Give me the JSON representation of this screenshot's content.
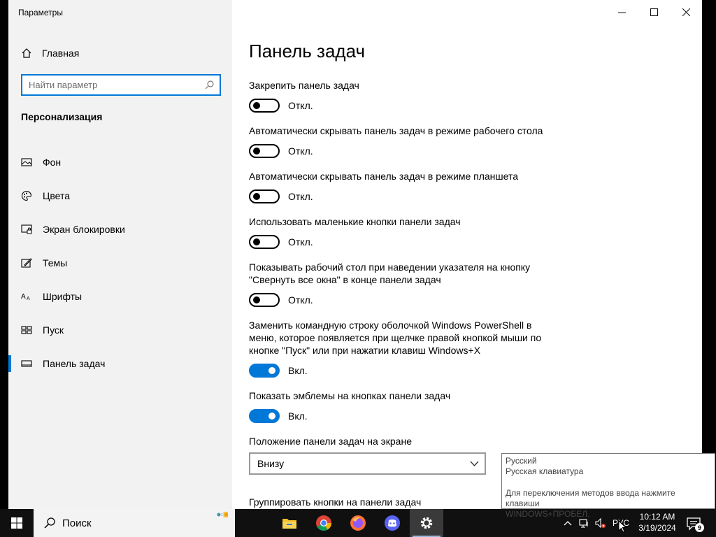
{
  "window": {
    "title": "Параметры",
    "accent_color": "#0078d7"
  },
  "sidebar": {
    "home_label": "Главная",
    "search_placeholder": "Найти параметр",
    "section_title": "Персонализация",
    "items": [
      {
        "label": "Фон",
        "icon": "image-icon"
      },
      {
        "label": "Цвета",
        "icon": "palette-icon"
      },
      {
        "label": "Экран блокировки",
        "icon": "lock-screen-icon"
      },
      {
        "label": "Темы",
        "icon": "themes-icon"
      },
      {
        "label": "Шрифты",
        "icon": "fonts-icon"
      },
      {
        "label": "Пуск",
        "icon": "start-icon"
      },
      {
        "label": "Панель задач",
        "icon": "taskbar-icon",
        "active": true
      }
    ]
  },
  "main": {
    "title": "Панель задач",
    "settings": [
      {
        "label": "Закрепить панель задач",
        "state": "Откл.",
        "on": false
      },
      {
        "label": "Автоматически скрывать панель задач в режиме рабочего стола",
        "state": "Откл.",
        "on": false
      },
      {
        "label": "Автоматически скрывать панель задач в режиме планшета",
        "state": "Откл.",
        "on": false
      },
      {
        "label": "Использовать маленькие кнопки панели задач",
        "state": "Откл.",
        "on": false
      },
      {
        "label": "Показывать рабочий стол при наведении указателя на кнопку \"Свернуть все окна\" в конце панели задач",
        "state": "Откл.",
        "on": false
      },
      {
        "label": "Заменить командную строку оболочкой Windows PowerShell в меню, которое появляется при щелчке правой кнопкой мыши по кнопке \"Пуск\" или при нажатии клавиш Windows+X",
        "state": "Вкл.",
        "on": true
      },
      {
        "label": "Показать эмблемы на кнопках панели задач",
        "state": "Вкл.",
        "on": true
      }
    ],
    "position_label": "Положение панели задач на экране",
    "position_value": "Внизу",
    "next_label": "Группировать кнопки на панели задач"
  },
  "tooltip": {
    "line1": "Русский",
    "line2": "Русская клавиатура",
    "line3": "Для переключения методов ввода нажмите клавиши",
    "line4": "WINDOWS+ПРОБЕЛ."
  },
  "taskbar": {
    "search_label": "Поиск",
    "apps": [
      "file-explorer-icon",
      "chrome-icon",
      "firefox-icon",
      "discord-icon",
      "settings-icon"
    ],
    "language": "РУС",
    "time": "10:12 AM",
    "date": "3/19/2024",
    "notification_count": "9"
  }
}
